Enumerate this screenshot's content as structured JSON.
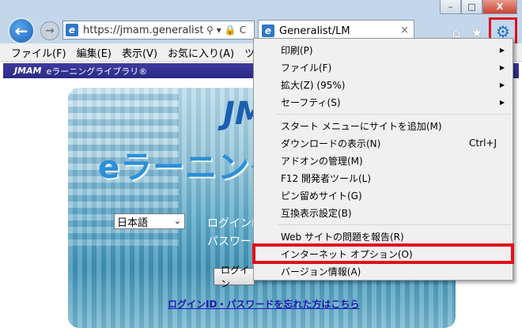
{
  "window": {
    "controls": [
      "–",
      "□",
      "X"
    ]
  },
  "nav": {
    "address_text": "https://jmam.generalist",
    "address_icons": [
      "⚲",
      "▾",
      "🔒",
      "C"
    ],
    "tab_title": "Generalist/LM",
    "tab_close": "×"
  },
  "menubar": {
    "items": [
      "ファイル(F)",
      "編集(E)",
      "表示(V)",
      "お気に入り(A)",
      "ツ"
    ]
  },
  "page": {
    "header_brand": "JMAM",
    "header_sub": "eラーニングライブラリ®",
    "banner_logo": "JM",
    "banner_title": "eラーニング",
    "lang_value": "日本語",
    "login_label": "ログインID",
    "pass_label": "パスワード",
    "login_button": "ログイン",
    "forgot_link": "ログインID・パスワードを忘れた方はこちら"
  },
  "dropdown": {
    "items": [
      {
        "label": "印刷(P)",
        "arrow": "▶",
        "shortcut": ""
      },
      {
        "label": "ファイル(F)",
        "arrow": "▶",
        "shortcut": ""
      },
      {
        "label": "拡大(Z) (95%)",
        "arrow": "▶",
        "shortcut": ""
      },
      {
        "label": "セーフティ(S)",
        "arrow": "▶",
        "shortcut": ""
      },
      {
        "label": "スタート メニューにサイトを追加(M)",
        "arrow": "",
        "shortcut": ""
      },
      {
        "label": "ダウンロードの表示(N)",
        "arrow": "",
        "shortcut": "Ctrl+J"
      },
      {
        "label": "アドオンの管理(M)",
        "arrow": "",
        "shortcut": ""
      },
      {
        "label": "F12 開発者ツール(L)",
        "arrow": "",
        "shortcut": ""
      },
      {
        "label": "ピン留めサイト(G)",
        "arrow": "",
        "shortcut": ""
      },
      {
        "label": "互換表示設定(B)",
        "arrow": "",
        "shortcut": ""
      },
      {
        "label": "Web サイトの問題を報告(R)",
        "arrow": "",
        "shortcut": ""
      },
      {
        "label": "インターネット オプション(O)",
        "arrow": "",
        "shortcut": ""
      },
      {
        "label": "バージョン情報(A)",
        "arrow": "",
        "shortcut": ""
      }
    ],
    "highlighted_item": "インターネット オプション(O)"
  },
  "colors": {
    "highlight_border": "#e0101a",
    "header_bg": "#2b2a86",
    "gear": "#1e70c8"
  }
}
